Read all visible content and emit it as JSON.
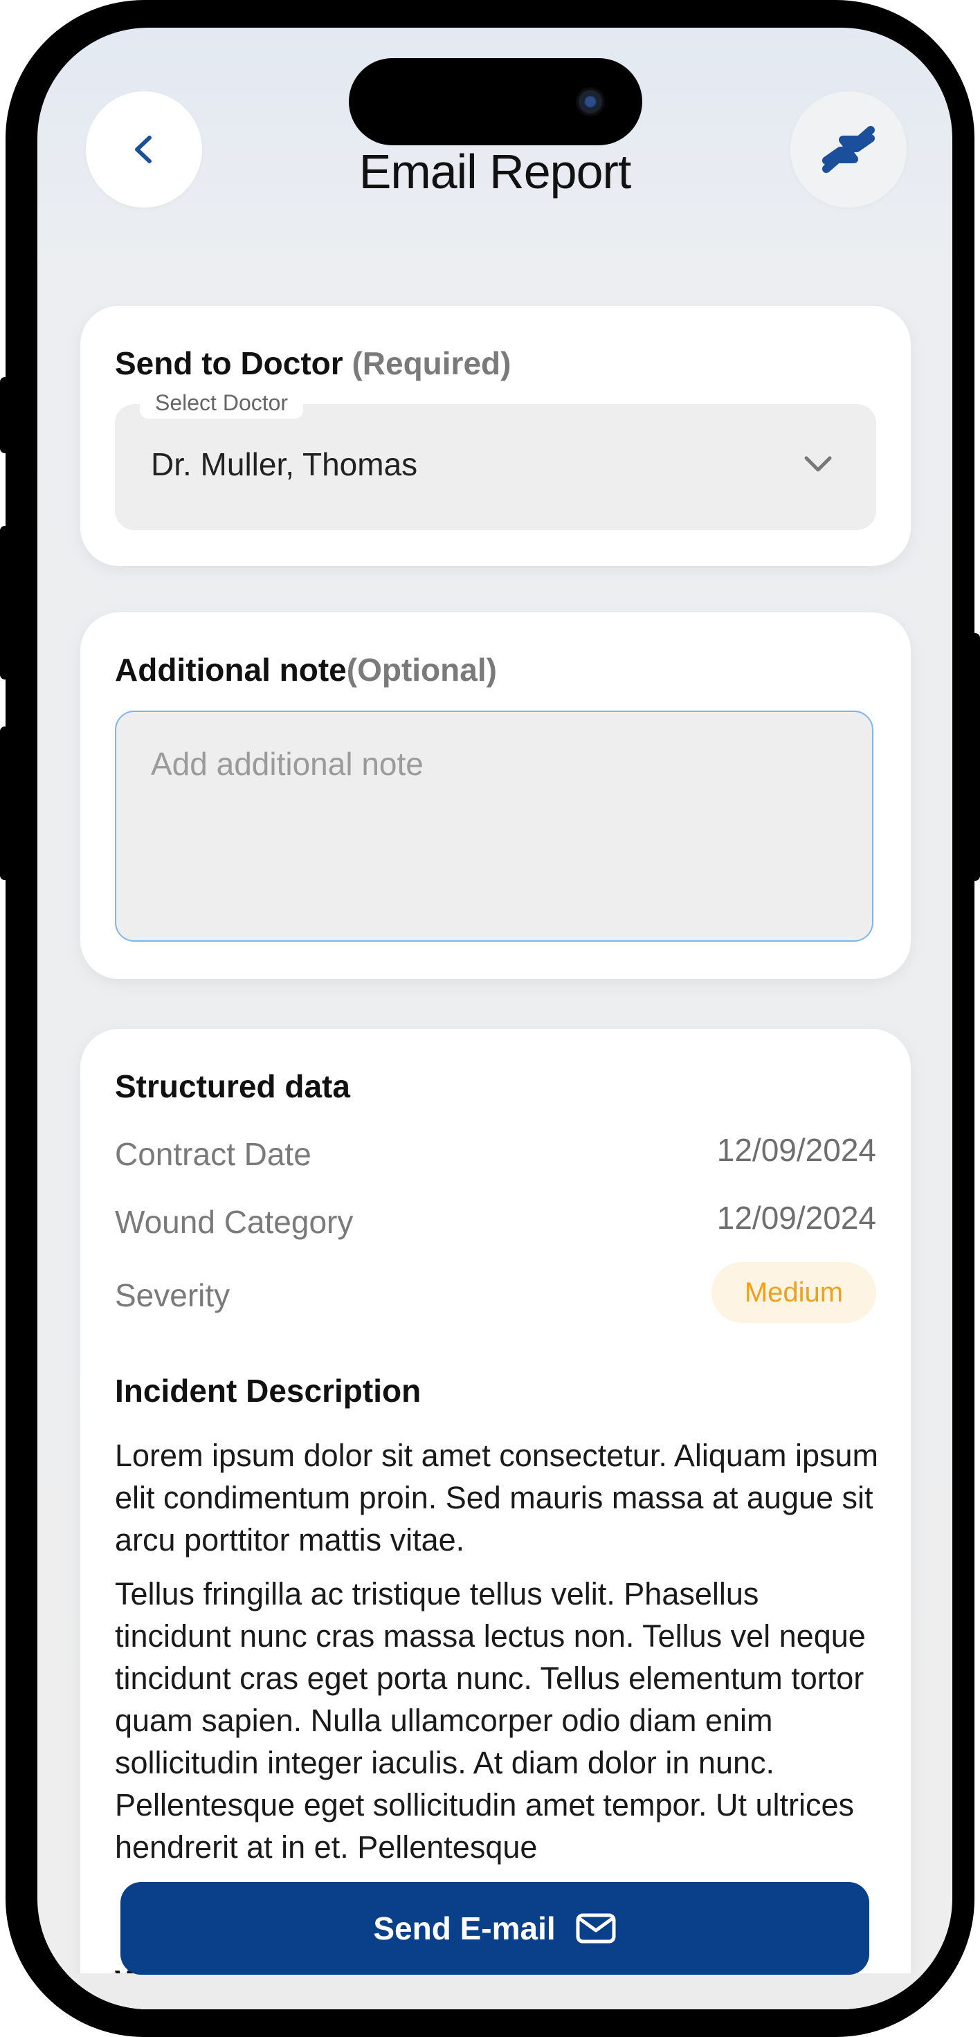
{
  "header": {
    "title": "Email Report"
  },
  "send_to_doctor": {
    "title": "Send to Doctor",
    "required_label": "(Required)",
    "field_label": "Select Doctor",
    "selected_value": "Dr. Muller, Thomas"
  },
  "additional_note": {
    "title": "Additional note",
    "optional_label": "(Optional)",
    "placeholder": "Add additional note"
  },
  "structured_data": {
    "title": "Structured data",
    "rows": [
      {
        "label": "Contract Date",
        "value": "12/09/2024"
      },
      {
        "label": "Wound Category",
        "value": "12/09/2024"
      },
      {
        "label": "Severity",
        "value": "Medium"
      }
    ],
    "severity_color": "#f0a11c"
  },
  "incident": {
    "title": "Incident Description",
    "paragraph1": "Lorem ipsum dolor sit amet consectetur. Aliquam ipsum elit condimentum proin. Sed mauris massa at augue sit arcu porttitor mattis vitae.",
    "paragraph2": "Tellus fringilla ac tristique tellus velit. Phasellus tincidunt nunc cras massa lectus non. Tellus vel neque tincidunt cras eget porta nunc. Tellus elementum tortor quam sapien. Nulla ullamcorper odio diam enim sollicitudin integer iaculis. At diam dolor in nunc. Pellentesque eget sollicitudin amet tempor. Ut ultrices hendrerit at in et. Pellentesque",
    "next_heading_partial": "W"
  },
  "footer": {
    "send_label": "Send E-mail"
  },
  "icons": {
    "back": "chevron-left-icon",
    "switch": "swap-hands-icon",
    "dropdown": "chevron-down-icon",
    "send": "mail-icon"
  },
  "colors": {
    "primary": "#0a3f8a",
    "accent_icon": "#1b4f9c",
    "input_focus_border": "#7fb6e6",
    "severity_badge_bg": "#fdf4e3"
  }
}
